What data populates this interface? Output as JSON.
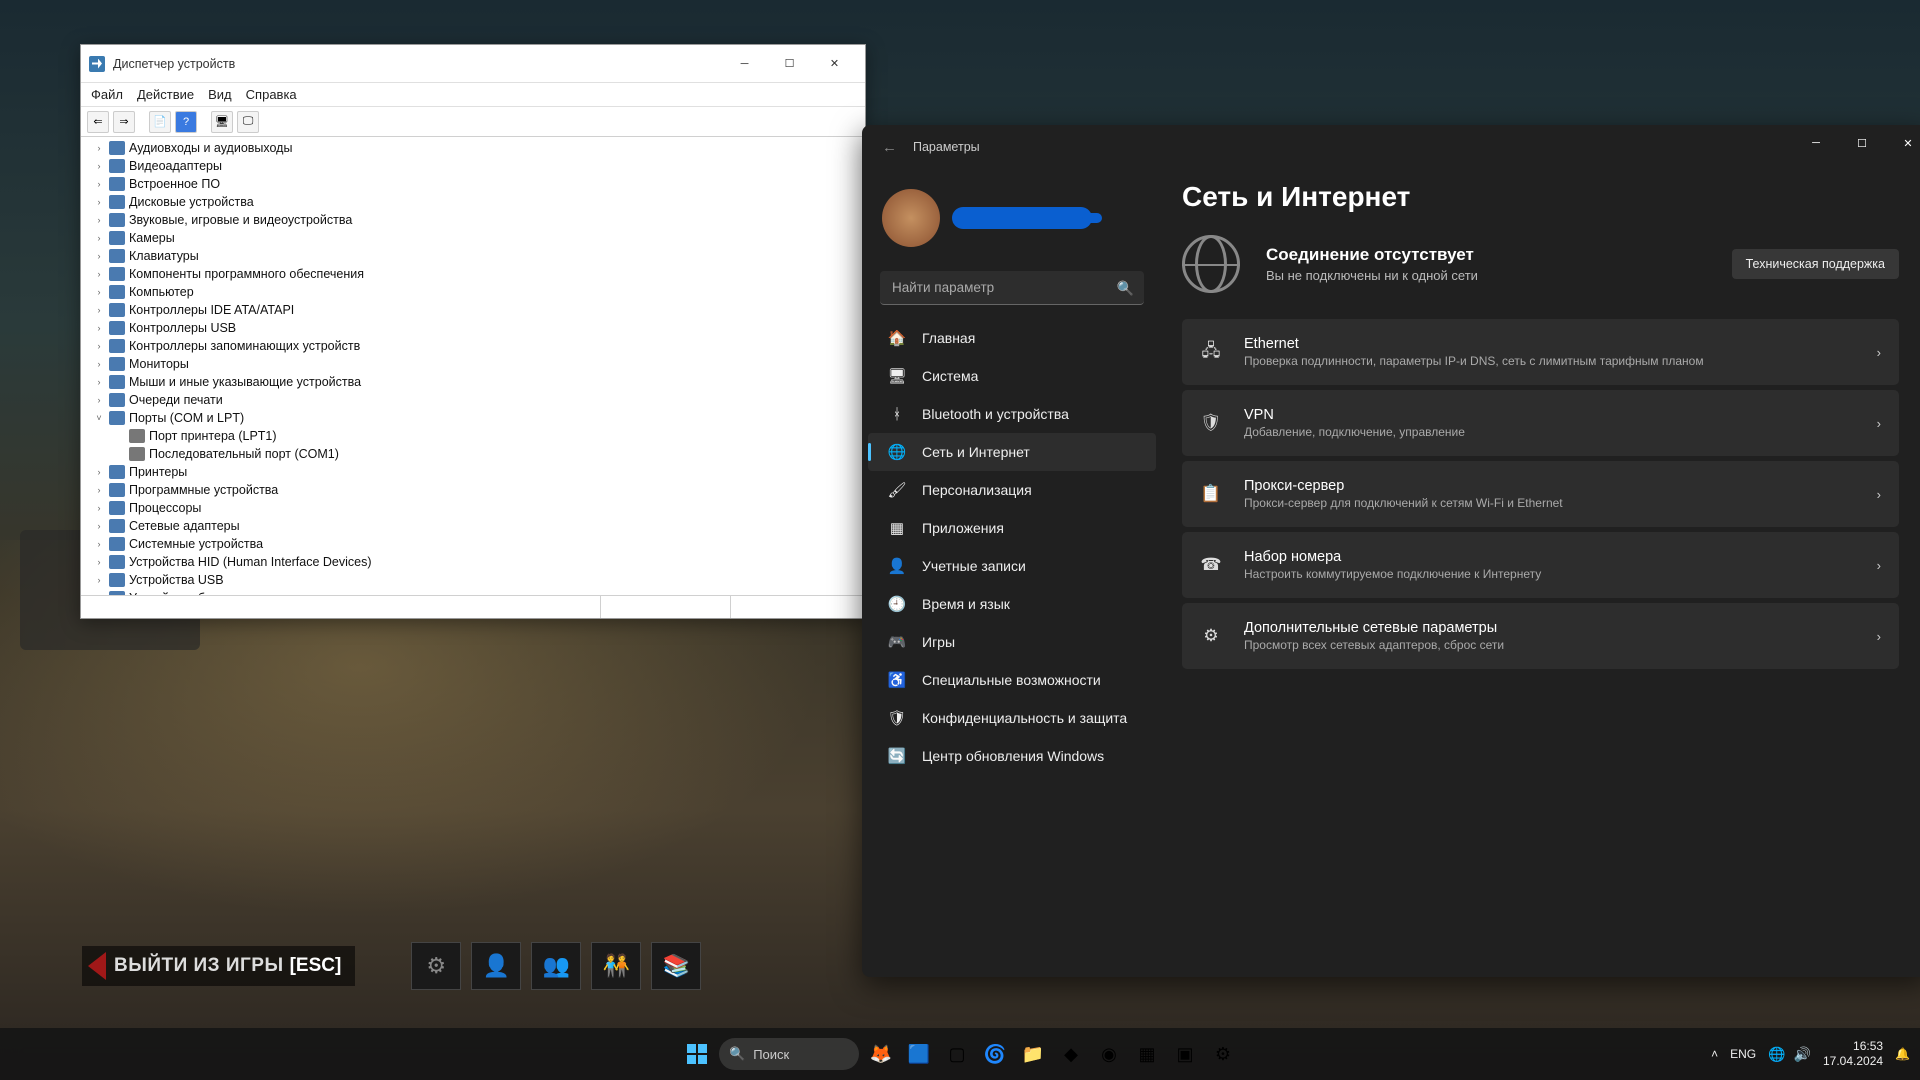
{
  "devmgr": {
    "title": "Диспетчер устройств",
    "menu": [
      "Файл",
      "Действие",
      "Вид",
      "Справка"
    ],
    "items": [
      {
        "label": "Аудиовходы и аудиовыходы",
        "exp": ">"
      },
      {
        "label": "Видеоадаптеры",
        "exp": ">"
      },
      {
        "label": "Встроенное ПО",
        "exp": ">"
      },
      {
        "label": "Дисковые устройства",
        "exp": ">"
      },
      {
        "label": "Звуковые, игровые и видеоустройства",
        "exp": ">"
      },
      {
        "label": "Камеры",
        "exp": ">"
      },
      {
        "label": "Клавиатуры",
        "exp": ">"
      },
      {
        "label": "Компоненты программного обеспечения",
        "exp": ">"
      },
      {
        "label": "Компьютер",
        "exp": ">"
      },
      {
        "label": "Контроллеры IDE ATA/ATAPI",
        "exp": ">"
      },
      {
        "label": "Контроллеры USB",
        "exp": ">"
      },
      {
        "label": "Контроллеры запоминающих устройств",
        "exp": ">"
      },
      {
        "label": "Мониторы",
        "exp": ">"
      },
      {
        "label": "Мыши и иные указывающие устройства",
        "exp": ">"
      },
      {
        "label": "Очереди печати",
        "exp": ">"
      },
      {
        "label": "Порты (COM и LPT)",
        "exp": "v",
        "children": [
          {
            "label": "Порт принтера (LPT1)"
          },
          {
            "label": "Последовательный порт (COM1)"
          }
        ]
      },
      {
        "label": "Принтеры",
        "exp": ">"
      },
      {
        "label": "Программные устройства",
        "exp": ">"
      },
      {
        "label": "Процессоры",
        "exp": ">"
      },
      {
        "label": "Сетевые адаптеры",
        "exp": ">"
      },
      {
        "label": "Системные устройства",
        "exp": ">"
      },
      {
        "label": "Устройства HID (Human Interface Devices)",
        "exp": ">"
      },
      {
        "label": "Устройства USB",
        "exp": ">"
      },
      {
        "label": "Устройства безопасности",
        "exp": ">"
      }
    ]
  },
  "settings": {
    "title": "Параметры",
    "search_placeholder": "Найти параметр",
    "nav": [
      {
        "icon": "🏠",
        "label": "Главная"
      },
      {
        "icon": "🖥",
        "label": "Система"
      },
      {
        "icon": "ᚼ",
        "label": "Bluetooth и устройства",
        "iconColor": "#4cc2ff"
      },
      {
        "icon": "🌐",
        "label": "Сеть и Интернет",
        "sel": true
      },
      {
        "icon": "🖌",
        "label": "Персонализация"
      },
      {
        "icon": "▦",
        "label": "Приложения"
      },
      {
        "icon": "👤",
        "label": "Учетные записи"
      },
      {
        "icon": "🕘",
        "label": "Время и язык"
      },
      {
        "icon": "🎮",
        "label": "Игры"
      },
      {
        "icon": "♿",
        "label": "Специальные возможности"
      },
      {
        "icon": "🛡",
        "label": "Конфиденциальность и защита"
      },
      {
        "icon": "🔄",
        "label": "Центр обновления Windows"
      }
    ],
    "page_title": "Сеть и Интернет",
    "conn_h": "Соединение отсутствует",
    "conn_s": "Вы не подключены ни к одной сети",
    "support_btn": "Техническая поддержка",
    "cards": [
      {
        "icon": "🖧",
        "h": "Ethernet",
        "s": "Проверка подлинности, параметры IP-и DNS, сеть с лимитным тарифным планом"
      },
      {
        "icon": "🛡",
        "h": "VPN",
        "s": "Добавление, подключение, управление"
      },
      {
        "icon": "📋",
        "h": "Прокси-сервер",
        "s": "Прокси-сервер для подключений к сетям Wi-Fi и Ethernet"
      },
      {
        "icon": "☎",
        "h": "Набор номера",
        "s": "Настроить коммутируемое подключение к Интернету"
      },
      {
        "icon": "⚙",
        "h": "Дополнительные сетевые параметры",
        "s": "Просмотр всех сетевых адаптеров, сброс сети"
      }
    ]
  },
  "hud": {
    "exit_text": "ВЫЙТИ ИЗ ИГРЫ",
    "exit_key": "[ESC]"
  },
  "taskbar": {
    "search": "Поиск",
    "lang": "ENG",
    "time": "16:53",
    "date": "17.04.2024"
  }
}
